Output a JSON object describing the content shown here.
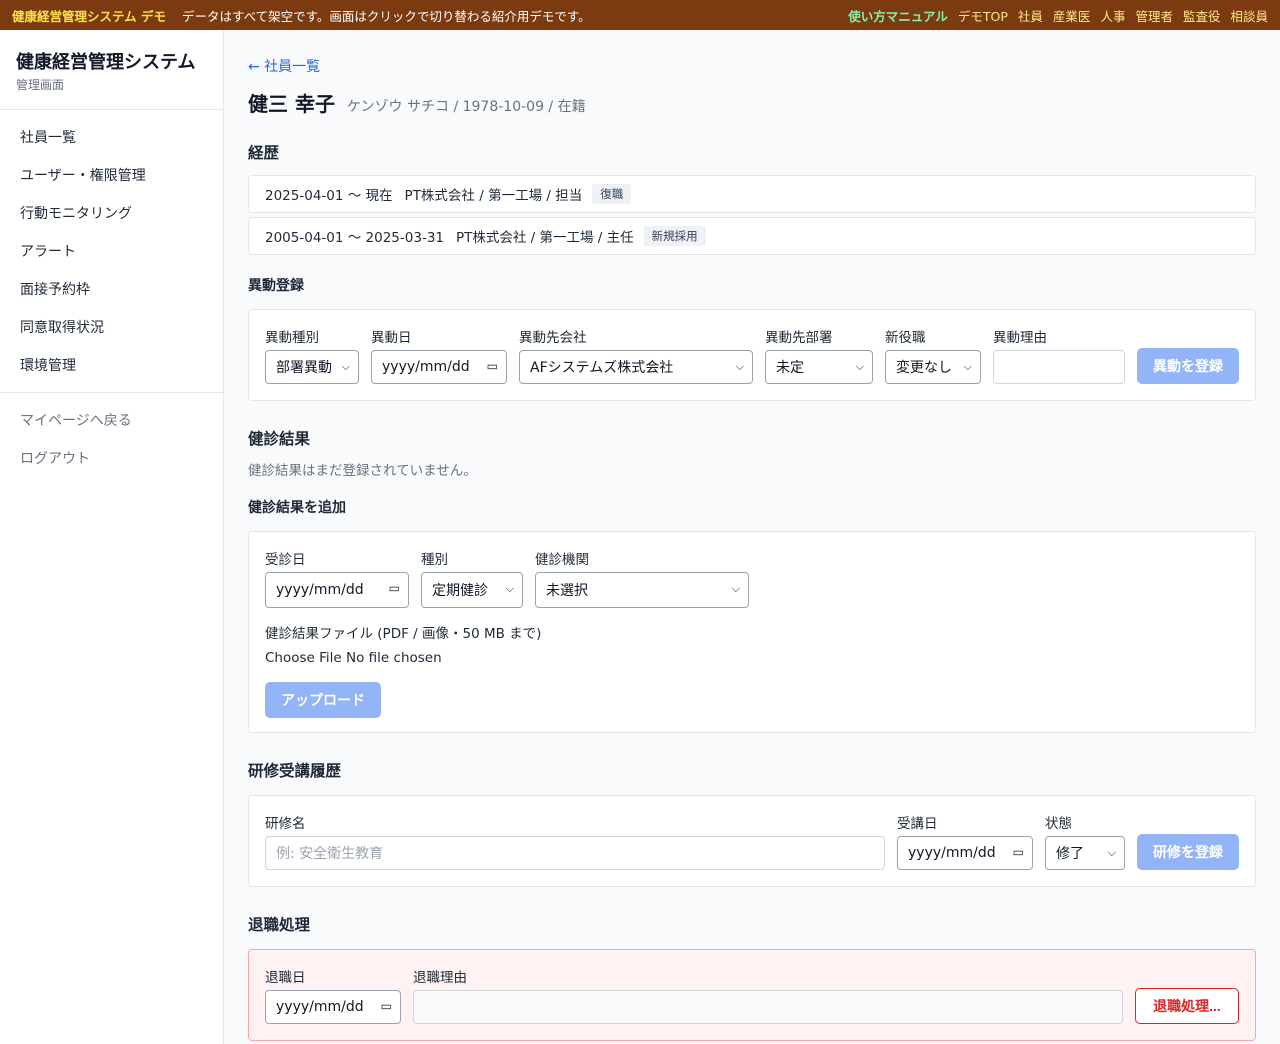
{
  "topbar": {
    "brand": "健康経営管理システム デモ",
    "notice": "データはすべて架空です。画面はクリックで切り替わる紹介用デモです。",
    "links": [
      "使い方マニュアル",
      "デモTOP",
      "社員",
      "産業医",
      "人事",
      "管理者",
      "監査役",
      "相談員"
    ]
  },
  "sidebar": {
    "title": "健康経営管理システム",
    "subtitle": "管理画面",
    "items": [
      "社員一覧",
      "ユーザー・権限管理",
      "行動モニタリング",
      "アラート",
      "面接予約枠",
      "同意取得状況",
      "環境管理"
    ],
    "footer_items": [
      "マイページへ戻る",
      "ログアウト"
    ]
  },
  "main": {
    "back_link": "← 社員一覧",
    "employee": {
      "name": "健三 幸子",
      "meta": "ケンゾウ サチコ / 1978-10-09 / 在籍"
    },
    "history": {
      "heading": "経歴",
      "items": [
        {
          "period": "2025-04-01 〜 現在",
          "company": "PT株式会社 / 第一工場 / 担当",
          "badge": "復職"
        },
        {
          "period": "2005-04-01 〜 2025-03-31",
          "company": "PT株式会社 / 第一工場 / 主任",
          "badge": "新規採用"
        }
      ]
    },
    "transfer": {
      "heading": "異動登録",
      "type_label": "異動種別",
      "type_value": "部署異動",
      "date_label": "異動日",
      "date_placeholder": "yyyy/mm/dd",
      "company_label": "異動先会社",
      "company_value": "AFシステムズ株式会社",
      "dept_label": "異動先部署",
      "dept_value": "未定",
      "position_label": "新役職",
      "position_value": "変更なし",
      "reason_label": "異動理由",
      "reason_value": "",
      "submit": "異動を登録"
    },
    "checkup": {
      "heading": "健診結果",
      "empty": "健診結果はまだ登録されていません。",
      "add_heading": "健診結果を追加",
      "date_label": "受診日",
      "date_placeholder": "yyyy/mm/dd",
      "kind_label": "種別",
      "kind_value": "定期健診",
      "org_label": "健診機関",
      "org_value": "未選択",
      "file_label": "健診結果ファイル (PDF / 画像・50 MB まで)",
      "file_choose": "Choose File",
      "file_status": "No file chosen",
      "upload": "アップロード"
    },
    "training": {
      "heading": "研修受講履歴",
      "name_label": "研修名",
      "name_placeholder": "例: 安全衛生教育",
      "date_label": "受講日",
      "date_placeholder": "yyyy/mm/dd",
      "status_label": "状態",
      "status_value": "修了",
      "submit": "研修を登録"
    },
    "retire": {
      "heading": "退職処理",
      "date_label": "退職日",
      "date_placeholder": "yyyy/mm/dd",
      "reason_label": "退職理由",
      "reason_value": "",
      "submit": "退職処理..."
    }
  },
  "colors": {
    "topbar": "#7c3a10",
    "brand": "#fde047",
    "manual": "#86efac",
    "link": "#2563eb",
    "primary_disabled": "#93b4f7",
    "danger": "#dc2626"
  }
}
